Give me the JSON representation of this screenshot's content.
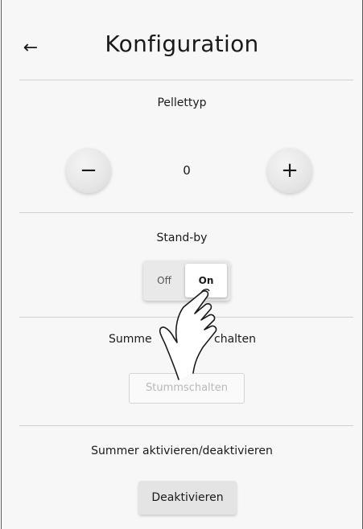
{
  "header": {
    "back_icon": "←",
    "title": "Konfiguration"
  },
  "pellet": {
    "label": "Pellettyp",
    "minus": "−",
    "plus": "+",
    "value": "0"
  },
  "standby": {
    "label": "Stand-by",
    "off": "Off",
    "on": "On",
    "selected": "On"
  },
  "buzzer_mute": {
    "label": "Summer stummschalten",
    "label_visible_left": "Summe",
    "label_visible_right": "chalten",
    "button": "Stummschalten",
    "button_state": "disabled"
  },
  "buzzer_toggle": {
    "label": "Summer aktivieren/deaktivieren",
    "button": "Deaktivieren"
  },
  "overlay": {
    "gesture": "tap-hand-icon"
  }
}
